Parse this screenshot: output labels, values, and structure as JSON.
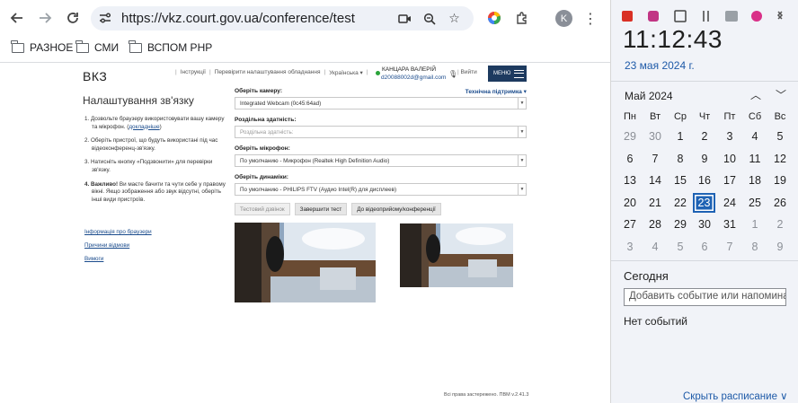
{
  "browser": {
    "url": "https://vkz.court.gov.ua/conference/test",
    "profile_initial": "K",
    "bookmarks": [
      {
        "label": "РАЗНОЕ"
      },
      {
        "label": "СМИ"
      },
      {
        "label": "ВСПОМ РНР"
      }
    ]
  },
  "site": {
    "brand": "ВКЗ",
    "links": [
      "Інструкції",
      "Перевірити налаштування обладнання",
      "Українська ▾"
    ],
    "user_name": "КАНЦАРА ВАЛЕРІЙ",
    "user_email": "d20088002d@gmail.com",
    "logout": "Вийти",
    "menu": "МЕНЮ"
  },
  "left": {
    "title": "Налаштування зв'язку",
    "step1": "1. Дозвольте браузеру використовувати вашу камеру та мікрофон. (",
    "step1_link": "докладніше",
    "step1_end": ")",
    "step2": "2. Оберіть пристрої, що будуть використані під час відеоконференц-зв'язку.",
    "step3": "3. Натисніть кнопку «Подзвонити» для перевірки зв'язку.",
    "step4_bold": "4. Важливо!",
    "step4": " Ви маєте бачити та чути себе у правому вікні. Якщо зображення або звук відсутні, оберіть інші види пристроїв.",
    "link_browser": "Інформація про браузери",
    "link_failures": "Причини відмови",
    "link_requirements": "Вимоги"
  },
  "form": {
    "support": "Технічна підтримка ▾",
    "camera_label": "Оберіть камеру:",
    "camera_value": "Integrated Webcam (0c45:64ad)",
    "resolution_label": "Роздільна здатність:",
    "resolution_placeholder": "Роздільна здатність:",
    "mic_label": "Оберіть мікрофон:",
    "mic_value": "По умолчанию - Микрофон (Realtek High Definition Audio)",
    "speaker_label": "Оберіть динаміки:",
    "speaker_value": "По умолчанию - PHILIPS FTV (Аудио Intel(R) для дисплеев)",
    "btn_test_call": "Тестовий дзвінок",
    "btn_finish": "Завершити тест",
    "btn_reception": "До відеоприйому/конференції"
  },
  "footer": "Всі права застережено. ПВМ v.2.41.3",
  "clock": {
    "time": "11:12:43",
    "date": "23 мая 2024 г.",
    "month": "Май 2024",
    "dow": [
      "Пн",
      "Вт",
      "Ср",
      "Чт",
      "Пт",
      "Сб",
      "Вс"
    ],
    "weeks": [
      [
        "29",
        "30",
        "1",
        "2",
        "3",
        "4",
        "5"
      ],
      [
        "6",
        "7",
        "8",
        "9",
        "10",
        "11",
        "12"
      ],
      [
        "13",
        "14",
        "15",
        "16",
        "17",
        "18",
        "19"
      ],
      [
        "20",
        "21",
        "22",
        "23",
        "24",
        "25",
        "26"
      ],
      [
        "27",
        "28",
        "29",
        "30",
        "31",
        "1",
        "2"
      ],
      [
        "3",
        "4",
        "5",
        "6",
        "7",
        "8",
        "9"
      ]
    ],
    "today_label": "Сегодня",
    "add_event_placeholder": "Добавить событие или напоминание",
    "no_events": "Нет событий",
    "hide_schedule": "Скрыть расписание ∨"
  },
  "colors": {
    "accent": "#1e62b4",
    "site_nav": "#1d3a5f",
    "link": "#1a4b8c"
  }
}
